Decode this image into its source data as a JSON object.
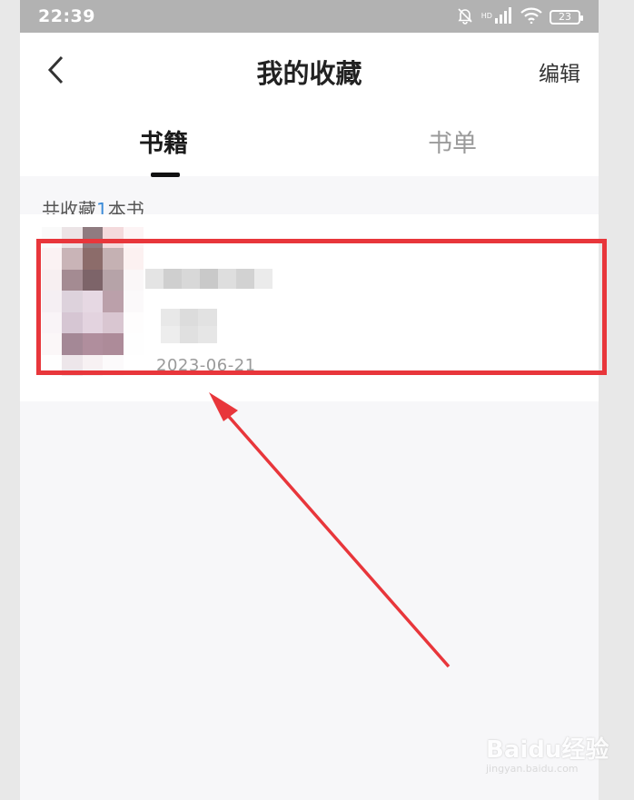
{
  "status_bar": {
    "time": "22:39",
    "network_label": "HD",
    "battery_level": "23"
  },
  "header": {
    "title": "我的收藏",
    "edit_label": "编辑"
  },
  "tabs": [
    {
      "label": "书籍",
      "active": true
    },
    {
      "label": "书单",
      "active": false
    }
  ],
  "summary": {
    "prefix": "共收藏",
    "count": "1",
    "suffix": "本书"
  },
  "book": {
    "title": "",
    "author": "",
    "date": "2023-06-21"
  },
  "colors": {
    "highlight": "#e8363b",
    "count_accent": "#3b8bd8"
  },
  "watermark": {
    "text": "Baidu经验",
    "url_text": "jingyan.baidu.com"
  }
}
